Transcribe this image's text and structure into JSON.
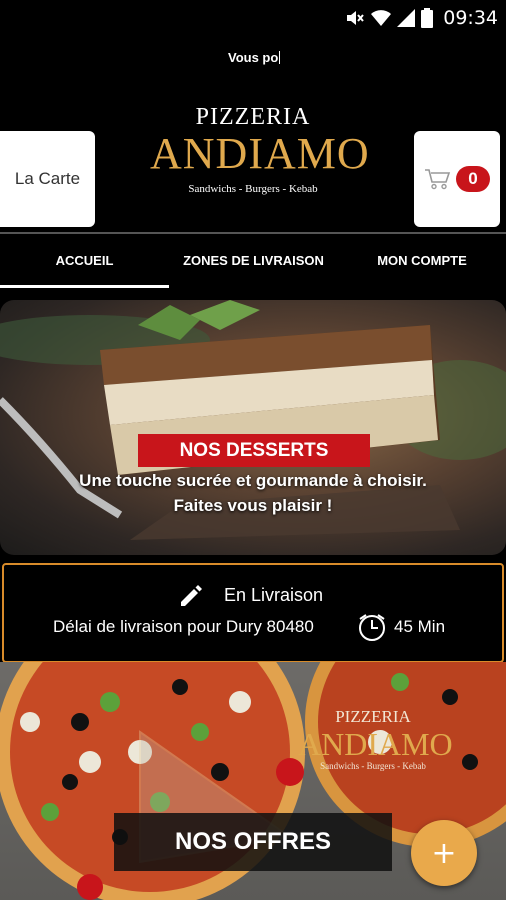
{
  "status_bar": {
    "time": "09:34"
  },
  "ticker": {
    "text": "Vous po"
  },
  "header": {
    "carte_label": "La Carte",
    "cart_count": "0",
    "logo": {
      "top": "PIZZERIA",
      "main": "ANDIAMO",
      "sub": "Sandwichs - Burgers - Kebab"
    }
  },
  "nav": {
    "items": [
      "ACCUEIL",
      "ZONES DE LIVRAISON",
      "MON COMPTE"
    ]
  },
  "hero": {
    "badge": "NOS DESSERTS",
    "line1": "Une touche sucrée et gourmande à choisir.",
    "line2": "Faites vous plaisir !"
  },
  "delivery": {
    "title": "En Livraison",
    "text": "Délai de livraison pour Dury 80480",
    "time": "45 Min"
  },
  "promo": {
    "logo": {
      "top": "PIZZERIA",
      "main": "ANDIAMO",
      "sub": "Sandwichs - Burgers - Kebab"
    },
    "offers_label": "NOS OFFRES",
    "fab_label": "+"
  },
  "colors": {
    "brand_gold": "#e0a94d",
    "badge_red": "#c8151b",
    "fab_orange": "#e9a94b",
    "delivery_border": "#d88b2a"
  }
}
